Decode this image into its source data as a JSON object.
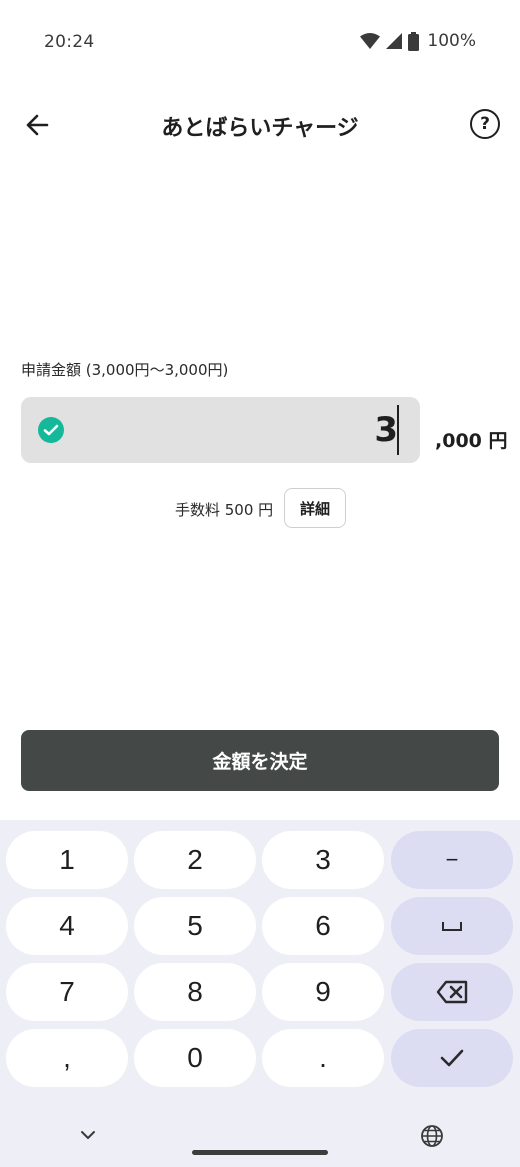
{
  "status_bar": {
    "time": "20:24",
    "battery_percent": "100%",
    "icons": [
      "wifi-icon",
      "signal-icon",
      "battery-icon"
    ]
  },
  "header": {
    "title": "あとばらいチャージ",
    "back_icon": "arrow-left-icon",
    "help_label": "?"
  },
  "form": {
    "amount_label": "申請金額 (3,000円〜3,000円)",
    "amount_value": "3",
    "amount_suffix": ",000 円",
    "valid_icon": "check-circle-icon",
    "fee_text": "手数料 500 円",
    "detail_button": "詳細",
    "submit_button": "金額を決定"
  },
  "keyboard": {
    "keys": [
      "1",
      "2",
      "3",
      "−",
      "4",
      "5",
      "6",
      "␣",
      "7",
      "8",
      "9",
      "⌫",
      ",",
      "0",
      ".",
      "✓"
    ]
  },
  "colors": {
    "accent_check": "#16b89a",
    "submit_bg": "#444948",
    "field_bg": "#e1e1e1",
    "keyboard_bg": "#eeeef6",
    "function_key_bg": "#dcdcf3"
  }
}
